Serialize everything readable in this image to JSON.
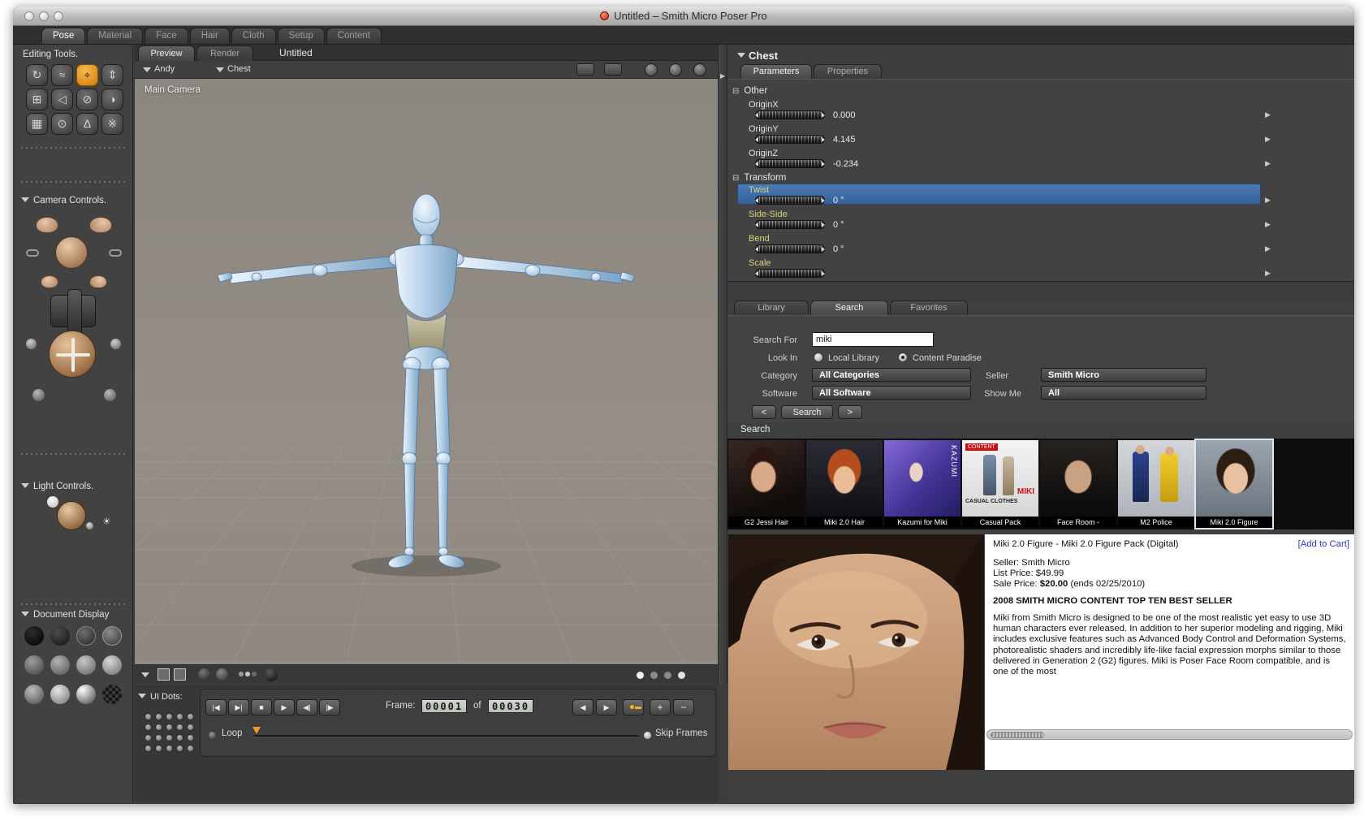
{
  "window": {
    "title": "Untitled – Smith Micro Poser Pro"
  },
  "room_tabs": [
    {
      "label": "Pose",
      "active": true
    },
    {
      "label": "Material"
    },
    {
      "label": "Face"
    },
    {
      "label": "Hair"
    },
    {
      "label": "Cloth"
    },
    {
      "label": "Setup"
    },
    {
      "label": "Content"
    }
  ],
  "left_panel": {
    "editing_tools_label": "Editing Tools.",
    "camera_controls_label": "Camera Controls.",
    "light_controls_label": "Light Controls.",
    "document_display_label": "Document Display"
  },
  "icons": {
    "rotate": "↻",
    "twist": "≈",
    "translate": "⌖",
    "translate_inout": "⇕",
    "scale": "⊞",
    "taper": "◁",
    "chain_break": "⊘",
    "color": "◑",
    "grouping": "▦",
    "view_magnifier": "⊙",
    "morphing_tool": "Δ",
    "direct_manipulation": "※",
    "sun": "☀",
    "panel_arrow": "▶",
    "row_arrow": "▶",
    "group_collapse": "⊟"
  },
  "viewport": {
    "tabs": [
      {
        "label": "Preview",
        "active": true
      },
      {
        "label": "Render"
      }
    ],
    "document_title": "Untitled",
    "figure_menu": "Andy",
    "actor_menu": "Chest",
    "camera_name": "Main Camera",
    "ui_dots_label": "UI Dots:"
  },
  "playback": {
    "transport_left": [
      "|◀",
      "▶|",
      "■",
      "▶",
      "◀|",
      "|▶"
    ],
    "frame_label": "Frame:",
    "frame_current": "00001",
    "of_label": "of",
    "frame_total": "00030",
    "transport_right": [
      "◀",
      "▶",
      "+",
      "−"
    ],
    "loop_label": "Loop",
    "skip_frames_label": "Skip Frames"
  },
  "parameters": {
    "header": "Chest",
    "tabs": [
      {
        "label": "Parameters",
        "active": true
      },
      {
        "label": "Properties"
      }
    ],
    "groups": [
      {
        "name": "Other",
        "params": [
          {
            "label": "OriginX",
            "value": "0.000"
          },
          {
            "label": "OriginY",
            "value": "4.145"
          },
          {
            "label": "OriginZ",
            "value": "-0.234"
          }
        ]
      },
      {
        "name": "Transform",
        "params": [
          {
            "label": "Twist",
            "value": "0 °",
            "selected": true
          },
          {
            "label": "Side-Side",
            "value": "0 °"
          },
          {
            "label": "Bend",
            "value": "0 °"
          },
          {
            "label": "Scale",
            "value": ""
          }
        ]
      }
    ]
  },
  "library": {
    "tabs": [
      {
        "label": "Library"
      },
      {
        "label": "Search",
        "active": true
      },
      {
        "label": "Favorites"
      }
    ],
    "search_for_label": "Search For",
    "search_value": "miki",
    "look_in_label": "Look In",
    "local_library_label": "Local Library",
    "content_paradise_label": "Content Paradise",
    "category_label": "Category",
    "category_value": "All Categories",
    "seller_label": "Seller",
    "seller_value": "Smith Micro",
    "software_label": "Software",
    "software_value": "All Software",
    "show_me_label": "Show Me",
    "show_me_value": "All",
    "prev_button_label": "<",
    "search_button_label": "Search",
    "next_button_label": ">",
    "results_heading": "Search",
    "thumbnails": [
      {
        "label": "G2 Jessi Hair"
      },
      {
        "label": "Miki 2.0 Hair"
      },
      {
        "label": "Kazumi for Miki",
        "image_text": "KAZUMI"
      },
      {
        "label": "Casual Pack",
        "image_lines": [
          "CONTENT",
          "CASUAL CLOTHES",
          "MIKI"
        ]
      },
      {
        "label": "Face Room -"
      },
      {
        "label": "M2 Police"
      },
      {
        "label": "Miki 2.0 Figure",
        "selected": true
      }
    ],
    "detail": {
      "title": "Miki 2.0 Figure - Miki 2.0 Figure Pack (Digital)",
      "add_to_cart_label": "[Add to Cart]",
      "seller_line": "Seller: Smith Micro",
      "list_price_line": "List Price: $49.99",
      "sale_price_prefix": "Sale Price: ",
      "sale_price_amount": "$20.00",
      "sale_price_suffix": " (ends 02/25/2010)",
      "best_seller_line": "2008 SMITH MICRO CONTENT TOP TEN BEST SELLER",
      "description": "Miki from Smith Micro is designed to be one of the most realistic yet easy to use 3D human characters ever released. In addition to her superior modeling and rigging, Miki includes exclusive features such as Advanced Body Control and Deformation Systems, photorealistic shaders and incredibly life-like facial expression morphs similar to those delivered in Generation 2 (G2) figures. Miki is Poser Face Room compatible, and is one of the most"
    }
  },
  "colors": {
    "tool_highlight_orange": "#e79a2e",
    "selected_param_row_blue": "#3c6ca8",
    "transform_label_yellow": "#d8d47a",
    "add_to_cart_blue": "#2d35c4"
  }
}
